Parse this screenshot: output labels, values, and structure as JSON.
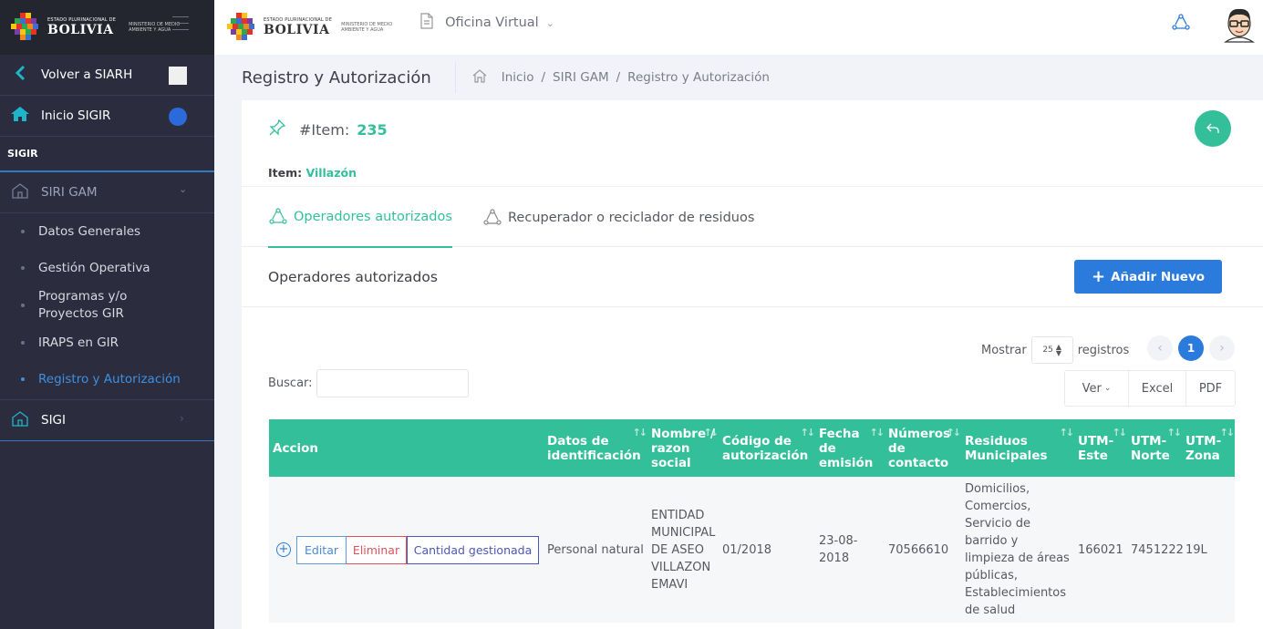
{
  "sidebar": {
    "logo": {
      "small": "ESTADO PLURINACIONAL DE",
      "big": "BOLIVIA",
      "ministry": "MINISTERIO DE MEDIO AMBIENTE Y AGUA"
    },
    "back_label": "Volver a SIARH",
    "home_label": "Inicio SIGIR",
    "section_label": "SIGIR",
    "group_label": "SIRI GAM",
    "sub_items": [
      "Datos Generales",
      "Gestión Operativa",
      "Programas y/o Proyectos GIR",
      "IRAPS en GIR",
      "Registro y Autorización"
    ],
    "sigi_label": "SIGI"
  },
  "topbar": {
    "logo": {
      "small": "ESTADO PLURINACIONAL DE",
      "big": "BOLIVIA",
      "ministry": "MINISTERIO DE MEDIO AMBIENTE Y AGUA"
    },
    "menu_label": "Oficina Virtual"
  },
  "subheader": {
    "title": "Registro y Autorización",
    "breadcrumb": [
      "Inicio",
      "SIRI GAM",
      "Registro y Autorización"
    ]
  },
  "item": {
    "hash_label": "#Item:",
    "number": "235",
    "name_label": "Item:",
    "name_value": "Villazón"
  },
  "tabs": [
    {
      "label": "Operadores autorizados",
      "active": true
    },
    {
      "label": "Recuperador o reciclador de residuos",
      "active": false
    }
  ],
  "section": {
    "title": "Operadores autorizados",
    "add_button": "Añadir Nuevo"
  },
  "table_controls": {
    "show_label": "Mostrar",
    "page_size": "25",
    "records_label": "registros",
    "search_label": "Buscar:",
    "search_value": "",
    "page": "1",
    "export_buttons": [
      "Ver",
      "Excel",
      "PDF"
    ]
  },
  "table": {
    "headers": [
      "Accion",
      "Datos de identificación",
      "Nombre / razon social",
      "Código de autorización",
      "Fecha de emisión",
      "Números de contacto",
      "Residuos Municipales",
      "UTM-Este",
      "UTM-Norte",
      "UTM-Zona"
    ],
    "row_actions": [
      "Editar",
      "Eliminar",
      "Cantidad gestionada"
    ],
    "rows": [
      {
        "datos": "Personal natural",
        "nombre": "ENTIDAD MUNICIPAL DE ASEO VILLAZON EMAVI",
        "codigo": "01/2018",
        "fecha": "23-08-2018",
        "contacto": "70566610",
        "residuos": "Domicilios, Comercios, Servicio de barrido y limpieza de áreas públicas, Establecimientos de salud",
        "utm_este": "166021",
        "utm_norte": "7451222",
        "utm_zona": "19L"
      }
    ]
  },
  "colors": {
    "sidebar_bg": "#2b2d3e",
    "accent_green": "#34bf9b",
    "primary_blue": "#2b7bdc",
    "danger": "#e05060",
    "teal": "#1fb5c8"
  }
}
